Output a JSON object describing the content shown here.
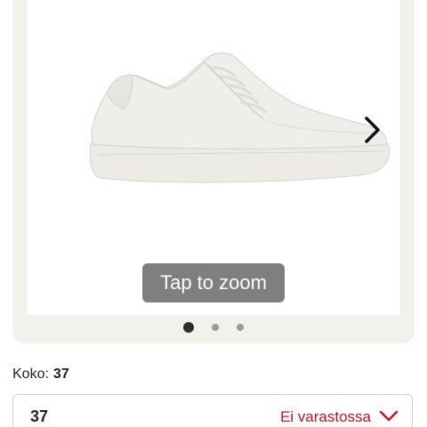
{
  "gallery": {
    "product_image": "white-leather-sneaker",
    "zoom_hint": "Tap to zoom",
    "next_icon": "chevron-right-icon",
    "page_count": 3,
    "active_page": 1
  },
  "size": {
    "label": "Koko:",
    "current": "37"
  },
  "size_select": {
    "selected": "37",
    "status": "Ei varastossa",
    "status_color": "#c8102e",
    "chevron_icon": "chevron-down-icon"
  },
  "colors": {
    "card_bg": "#f3f1ec",
    "zoom_pill_bg": "#7b7b7b",
    "dot_active": "#2f2f2f",
    "dot_inactive": "#9a9a9a"
  }
}
